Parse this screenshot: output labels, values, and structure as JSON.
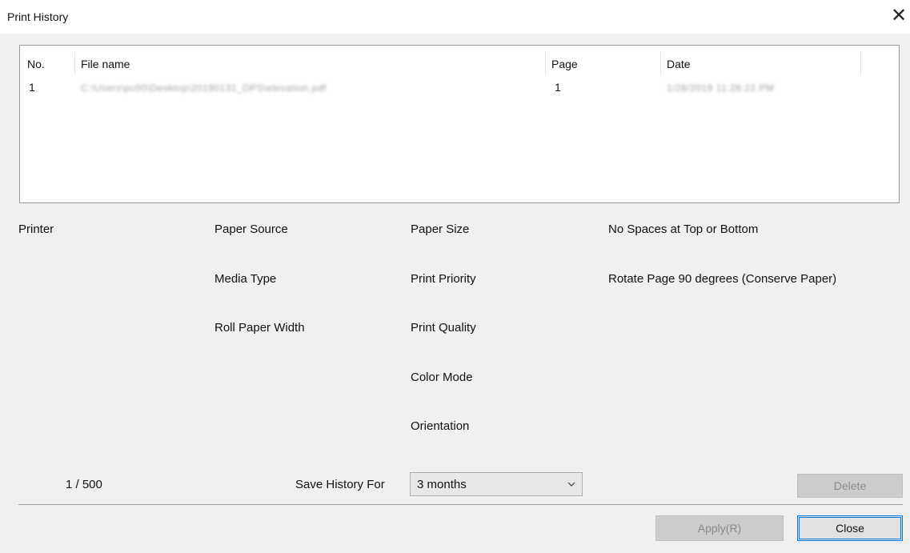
{
  "window": {
    "title": "Print History",
    "close_glyph": "✕",
    "close_icon": "close-icon"
  },
  "history_list": {
    "columns": [
      "No.",
      "File name",
      "Page",
      "Date"
    ],
    "rows": [
      {
        "no": "1",
        "file_name": "C:\\Users\\pc00\\Desktop\\20190131_DPS\\elevation.pdf",
        "page": "1",
        "date": "1/28/2019 11:28:22 PM"
      }
    ]
  },
  "detail_labels": {
    "printer": "Printer",
    "paper_source": "Paper Source",
    "media_type": "Media Type",
    "roll_paper_width": "Roll Paper Width",
    "paper_size": "Paper Size",
    "print_priority": "Print Priority",
    "print_quality": "Print Quality",
    "color_mode": "Color Mode",
    "orientation": "Orientation",
    "no_spaces": "No Spaces at Top or Bottom",
    "rotate_page": "Rotate Page 90 degrees (Conserve Paper)"
  },
  "footer": {
    "count": "1 / 500",
    "save_history_label": "Save History For",
    "save_history_value": "3 months",
    "delete_label": "Delete",
    "apply_label": "Apply(R)",
    "close_label": "Close"
  }
}
